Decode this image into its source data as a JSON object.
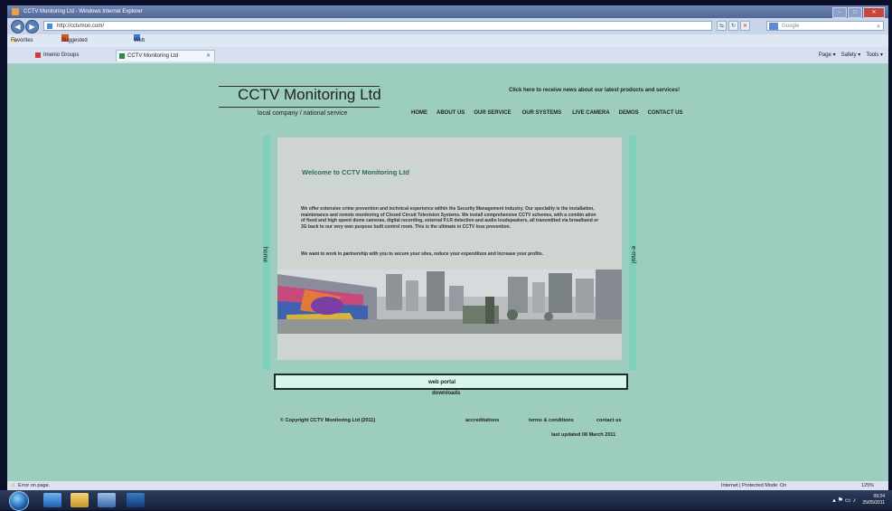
{
  "window": {
    "title": "CCTV Monitoring Ltd - Windows Internet Explorer",
    "minimize": "–",
    "maximize": "□",
    "close": "✕"
  },
  "address": {
    "back": "◀",
    "forward": "▶",
    "url": "http://cctvmon.com/",
    "refresh": "↻",
    "stop": "✕",
    "compat": "⇆",
    "search_placeholder": "Google",
    "search_glyph": "⌕"
  },
  "favorites": {
    "label": "Favorites",
    "suggested": "Suggested Sites ▾",
    "gallery": "Web Slice Gallery ▾"
  },
  "tabs": [
    {
      "label": "Imenio Groups"
    },
    {
      "label": "CCTV Monitoring Ltd"
    }
  ],
  "tabs_close": "✕",
  "command_bar": [
    "Page ▾",
    "Safety ▾",
    "Tools ▾"
  ],
  "site": {
    "logo": "CCTV Monitoring Ltd",
    "tagline": "local company / national service",
    "promo": "Click here to receive news about our latest products and services!",
    "nav": [
      "HOME",
      "ABOUT US",
      "OUR SERVICE",
      "OUR SYSTEMS",
      "LIVE CAMERA",
      "DEMOS",
      "CONTACT US"
    ],
    "side_left": "home",
    "side_right": "e-mail",
    "welcome": "Welcome to CCTV Monitoring Ltd",
    "para1": "We offer extensive crime prevention and technical experience within the Security Management industry. Our speciality is the installation, maintenance and remote monitoring of Closed Circuit Television Systems. We install comprehensive CCTV schemes, with a combin ation of fixed and high speed dome cameras, digital recording, external P.I.R detection and audio loudspeakers, all transmitted via broadband or 3G back to our very own purpose built control room. This is the ultimate in CCTV loss prevention.",
    "para2": "We want to work in partnership with you to secure your sites, reduce your expenditure and increase your profits.",
    "web_portal": "web portal",
    "downloads": "downloads",
    "copyright": "© Copyright CCTV Monitoring Ltd (2011)",
    "accreditations": "accreditations",
    "terms": "terms & conditions",
    "contact": "contact us",
    "updated": "last updated 08 March 2011"
  },
  "status": {
    "left": "Error on page.",
    "zone": "Internet | Protected Mode: On",
    "zoom": "125%"
  },
  "taskbar": {
    "time": "09:24",
    "date": "25/05/2011"
  },
  "colors": {
    "page_bg": "#9dcdbf",
    "rail": "#7fd0b8",
    "content_bg": "#ced4cf",
    "welcome_text": "#2c6b62",
    "portal_bg": "#d9f6ee"
  }
}
